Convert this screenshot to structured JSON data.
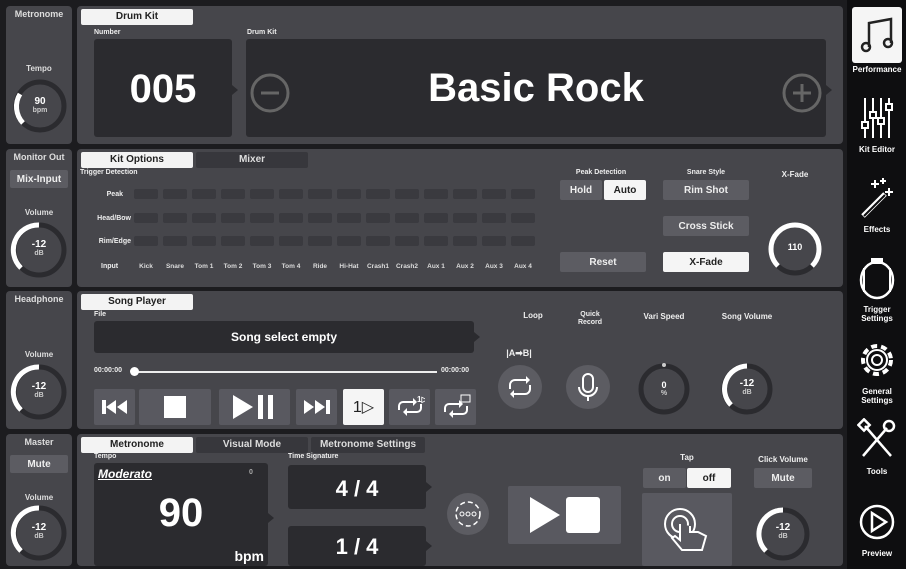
{
  "metronome_side": {
    "title": "Metronome",
    "tempo_label": "Tempo",
    "tempo_value": "90",
    "tempo_unit": "bpm"
  },
  "monitor_out": {
    "title": "Monitor Out",
    "button": "Mix-Input",
    "volume_label": "Volume",
    "value": "-12",
    "unit": "dB"
  },
  "headphone": {
    "title": "Headphone",
    "volume_label": "Volume",
    "value": "-12",
    "unit": "dB"
  },
  "master": {
    "title": "Master",
    "button": "Mute",
    "volume_label": "Volume",
    "value": "-12",
    "unit": "dB"
  },
  "drum_kit": {
    "tab": "Drum Kit",
    "number_label": "Number",
    "kit_label": "Drum Kit",
    "number": "005",
    "name": "Basic Rock"
  },
  "kit_options": {
    "tabs": [
      "Kit Options",
      "Mixer"
    ],
    "trigger_label": "Trigger Detection",
    "rows": [
      "Peak",
      "Head/Bow",
      "Rim/Edge"
    ],
    "input_label": "Input",
    "inputs": [
      "Kick",
      "Snare",
      "Tom 1",
      "Tom 2",
      "Tom 3",
      "Tom 4",
      "Ride",
      "Hi-Hat",
      "Crash1",
      "Crash2",
      "Aux 1",
      "Aux 2",
      "Aux 3",
      "Aux 4"
    ],
    "peak_detection_label": "Peak Detection",
    "hold": "Hold",
    "auto": "Auto",
    "reset": "Reset",
    "snare_style_label": "Snare Style",
    "rim_shot": "Rim Shot",
    "cross_stick": "Cross Stick",
    "x_fade_btn": "X-Fade",
    "x_fade_label": "X-Fade",
    "x_fade_value": "110"
  },
  "song_player": {
    "tab": "Song Player",
    "file_label": "File",
    "song": "Song select empty",
    "time_start": "00:00:00",
    "time_end": "00:00:00",
    "loop_label": "Loop",
    "ab_label": "|A➡B|",
    "quick_record_label": "Quick\nRecord",
    "vari_speed_label": "Vari Speed",
    "vari_value": "0",
    "vari_unit": "%",
    "song_volume_label": "Song Volume",
    "song_vol_value": "-12",
    "song_vol_unit": "dB",
    "single_play": "1▷"
  },
  "metronome": {
    "tabs": [
      "Metronome",
      "Visual Mode",
      "Metronome Settings"
    ],
    "tempo_label": "Tempo",
    "tempo_name": "Moderato",
    "tempo_small": "0",
    "tempo": "90",
    "bpm": "bpm",
    "time_sig_label": "Time Signature",
    "time_sig": "4 / 4",
    "sub": "1 / 4",
    "tap_label": "Tap",
    "on": "on",
    "off": "off",
    "click_volume_label": "Click Volume",
    "mute": "Mute",
    "click_vol_value": "-12",
    "click_vol_unit": "dB"
  },
  "sidebar": [
    {
      "label": "Performance",
      "icon": "music-note-icon"
    },
    {
      "label": "Kit Editor",
      "icon": "sliders-icon"
    },
    {
      "label": "Effects",
      "icon": "magic-wand-icon"
    },
    {
      "label": "Trigger\nSettings",
      "icon": "drum-icon"
    },
    {
      "label": "General\nSettings",
      "icon": "gear-icon"
    },
    {
      "label": "Tools",
      "icon": "tools-icon"
    },
    {
      "label": "Preview",
      "icon": "play-circle-icon"
    }
  ]
}
